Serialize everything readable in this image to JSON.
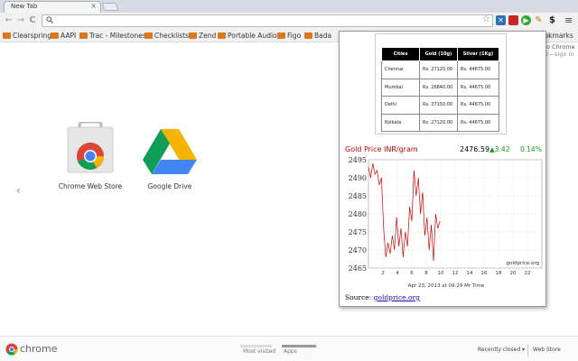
{
  "tab": {
    "title": "New Tab",
    "close": "×"
  },
  "toolbar": {
    "back": "←",
    "forward": "→",
    "reload": "C",
    "search_glyph": "🔍",
    "star": "☆",
    "dollar": "$",
    "menu": "≡"
  },
  "bookmarks": [
    {
      "label": "Clearspring"
    },
    {
      "label": "AAPI"
    },
    {
      "label": "Trac - Milestones"
    },
    {
      "label": "Checklists"
    },
    {
      "label": "Zend"
    },
    {
      "label": "Portable Audio"
    },
    {
      "label": "Figo"
    },
    {
      "label": "Bada"
    }
  ],
  "bookmarks_overflow": "ookmarks",
  "apps": [
    {
      "label": "Chrome Web Store",
      "icon": "chrome-web-store-icon"
    },
    {
      "label": "Google Drive",
      "icon": "google-drive-icon"
    }
  ],
  "nav_chevron": "‹",
  "popup": {
    "clip_right_line1": "o Chrome",
    "clip_right_line2": "t—sign in",
    "table": {
      "headers": [
        "Cities",
        "Gold (10g)",
        "Silver (1Kg)"
      ],
      "rows": [
        [
          "Chennai",
          "Rs. 27120.00",
          "Rs. 44675.00"
        ],
        [
          "Mumbai",
          "Rs. 26840.00",
          "Rs. 44675.00"
        ],
        [
          "Delhi",
          "Rs. 27150.00",
          "Rs. 44675.00"
        ],
        [
          "Kolkata",
          "Rs. 27120.00",
          "Rs. 44675.00"
        ]
      ]
    },
    "gold_title": "Gold Price INR/gram",
    "gold_price": "2476.59",
    "gold_change": "▲3.42",
    "gold_pct": "0.14%",
    "source_label": "Source:",
    "source_link": "goldprice.org",
    "colors": {
      "title": "#cc0000",
      "up": "#1a9a1a",
      "line": "#d00000"
    }
  },
  "chart_data": {
    "type": "line",
    "title": "",
    "xlabel": "Apr 23, 2013 at 09:29 Mr Time",
    "ylabel": "",
    "watermark": "goldprice.org",
    "x_ticks": [
      "2",
      "4",
      "6",
      "8",
      "10",
      "12",
      "14",
      "16",
      "18",
      "20",
      "22"
    ],
    "y_ticks": [
      "2495",
      "2490",
      "2485",
      "2480",
      "2475",
      "2470",
      "2465"
    ],
    "ylim": [
      2465,
      2495
    ],
    "xlim": [
      0,
      24
    ],
    "grid": true,
    "series": [
      {
        "x": [
          0.0,
          0.3,
          0.6,
          0.9,
          1.2,
          1.5,
          1.8,
          2.1,
          2.4,
          2.7,
          3.0,
          3.3,
          3.6,
          3.9,
          4.2,
          4.5,
          4.8,
          5.1,
          5.4,
          5.7,
          6.0,
          6.3,
          6.6,
          6.9,
          7.2,
          7.5,
          7.8,
          8.1,
          8.4,
          8.7,
          9.0,
          9.3,
          9.6,
          9.9
        ],
        "values": [
          2493,
          2490,
          2494,
          2491,
          2492,
          2488,
          2490,
          2476,
          2468,
          2472,
          2469,
          2474,
          2470,
          2479,
          2471,
          2476,
          2468,
          2475,
          2471,
          2482,
          2478,
          2492,
          2485,
          2490,
          2480,
          2486,
          2474,
          2479,
          2470,
          2477,
          2467,
          2480,
          2476,
          2478
        ]
      }
    ]
  },
  "bottom": {
    "chrome_word": "chrome",
    "most_visited": "Most visited",
    "apps": "Apps",
    "recently_closed": "Recently closed ▾",
    "web_store": "Web Store"
  }
}
